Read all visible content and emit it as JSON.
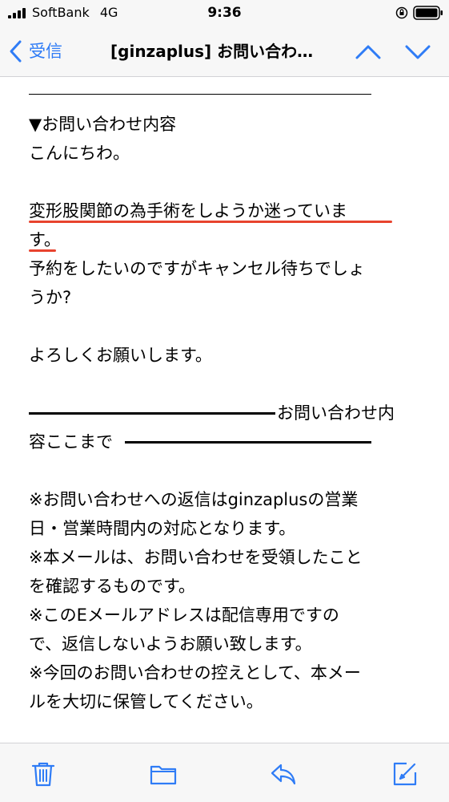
{
  "status_bar": {
    "carrier": "SoftBank",
    "network": "4G",
    "time": "9:36"
  },
  "nav": {
    "back_label": "受信",
    "title": "[ginzaplus] お問い合わ…"
  },
  "mail": {
    "section_heading": "▼お問い合わせ内容",
    "greeting": "こんにちわ。",
    "body_lines": [
      "変形股関節の為手術をしようか迷っていま",
      "す。",
      "予約をしたいのですがキャンセル待ちでしょ",
      "うか?"
    ],
    "closing": "よろしくお願いします。",
    "end_marker_a": "お問い合わせ内",
    "end_marker_b": "容ここまで",
    "notice_lines": [
      "※お問い合わせへの返信はginzaplusの営業",
      "日・営業時間内の対応となります。",
      "※本メールは、お問い合わせを受領したこと",
      "を確認するものです。",
      "※このEメールアドレスは配信専用ですの",
      "で、返信しないようお願い致します。",
      "※今回のお問い合わせの控えとして、本メー",
      "ルを大切に保管してください。"
    ]
  },
  "colors": {
    "accent": "#2f7cf6",
    "highlight": "#e8432e",
    "bar_background": "#f7f7f7"
  },
  "toolbar": {
    "icons": [
      "trash-icon",
      "folder-icon",
      "reply-icon",
      "compose-icon"
    ]
  }
}
